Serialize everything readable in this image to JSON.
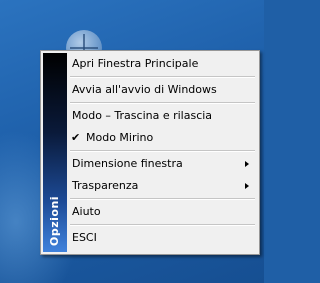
{
  "menu": {
    "banner_title": "Opzioni",
    "items": [
      {
        "label": "Apri Finestra Principale"
      },
      {
        "label": "Avvia all'avvio di Windows"
      },
      {
        "label": "Modo – Trascina e rilascia"
      },
      {
        "label": "Modo Mirino",
        "checked": true,
        "check_glyph": "✔"
      },
      {
        "label": "Dimensione finestra",
        "submenu": true
      },
      {
        "label": "Trasparenza",
        "submenu": true
      },
      {
        "label": "Aiuto"
      },
      {
        "label": "ESCI"
      }
    ]
  },
  "colors": {
    "desktop": "#1f5fa6",
    "menu_background": "#f0f0f0",
    "banner_top": "#000000",
    "banner_bottom": "#3f82dc"
  },
  "icons": {
    "desktop_app": "crosshair-globe-icon",
    "checkmark": "check-icon",
    "submenu_arrow": "chevron-right-icon"
  }
}
